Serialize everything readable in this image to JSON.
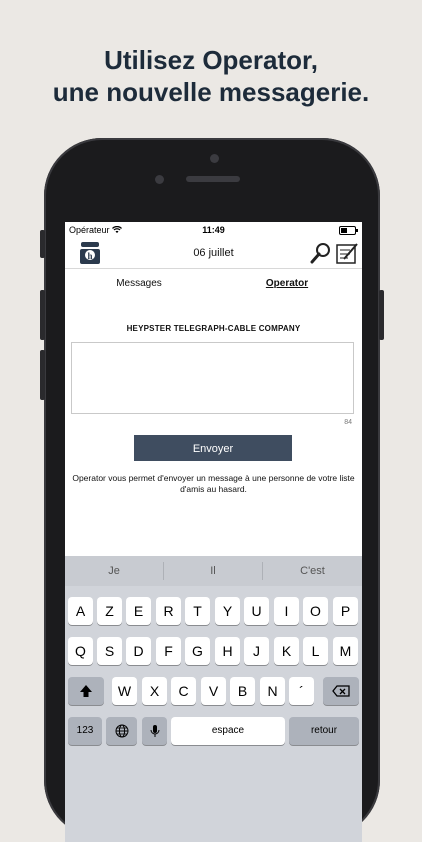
{
  "headline": {
    "line1": "Utilisez Operator,",
    "line2": "une nouvelle messagerie."
  },
  "status": {
    "carrier": "Opérateur",
    "time": "11:49"
  },
  "nav": {
    "date": "06 juillet",
    "left_icon": "telephone-logo-icon",
    "search_icon": "magnifier-icon",
    "compose_icon": "compose-icon"
  },
  "tabs": {
    "messages": "Messages",
    "operator": "Operator"
  },
  "content": {
    "company": "HEYPSTER TELEGRAPH-CABLE COMPANY",
    "message_value": "",
    "char_count": "84",
    "send_label": "Envoyer",
    "info": "Operator vous permet d'envoyer un message à une personne de votre liste d'amis au hasard."
  },
  "keyboard": {
    "suggestions": [
      "Je",
      "Il",
      "C'est"
    ],
    "row1": [
      "A",
      "Z",
      "E",
      "R",
      "T",
      "Y",
      "U",
      "I",
      "O",
      "P"
    ],
    "row2": [
      "Q",
      "S",
      "D",
      "F",
      "G",
      "H",
      "J",
      "K",
      "L",
      "M"
    ],
    "row3": [
      "W",
      "X",
      "C",
      "V",
      "B",
      "N",
      "´"
    ],
    "numbers": "123",
    "space": "espace",
    "return": "retour"
  }
}
